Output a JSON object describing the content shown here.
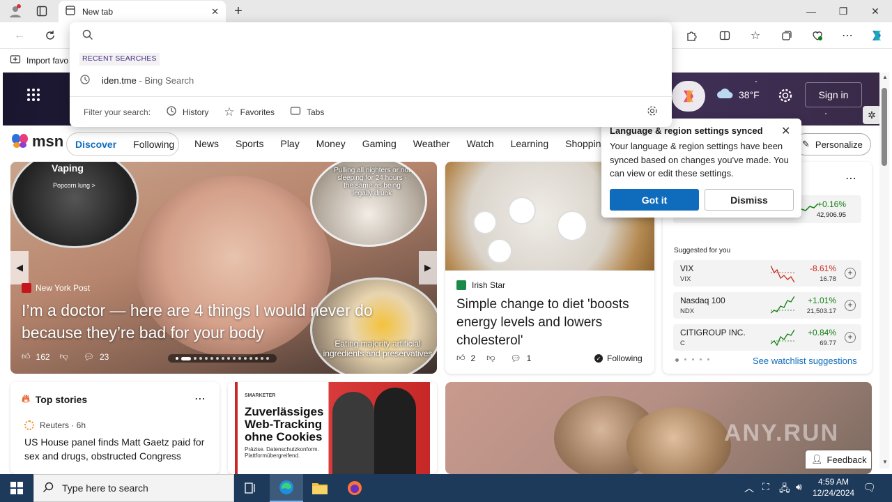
{
  "browser": {
    "tab_title": "New tab",
    "favorites_bar": {
      "import_label": "Import favo"
    },
    "window_controls": {
      "minimize": "—",
      "maximize": "❐",
      "close": "✕"
    }
  },
  "omnibox": {
    "recent_label": "RECENT SEARCHES",
    "recent_item": {
      "query": "iden.tme",
      "source": "- Bing Search"
    },
    "filter_label": "Filter your search:",
    "filters": [
      "History",
      "Favorites",
      "Tabs"
    ]
  },
  "msn": {
    "logo": "msn",
    "weather": {
      "temp": "38°F"
    },
    "sign_in": "Sign in",
    "nav": {
      "discover": "Discover",
      "following": "Following",
      "items": [
        "News",
        "Sports",
        "Play",
        "Money",
        "Gaming",
        "Weather",
        "Watch",
        "Learning",
        "Shopping"
      ],
      "personalize": "Personalize"
    },
    "hero_card": {
      "source": "New York Post",
      "headline": "I’m a doctor — here are 4 things I would never do because they’re bad for your body",
      "likes": "162",
      "comments": "23",
      "overlay_1": "Vaping",
      "overlay_2": "Popcorn lung >",
      "overlay_3": "Pulling all nighters or not sleeping for 24 hours - the same as being legally drunk",
      "overlay_4": "Eating majority artificial ingredients and preservatives"
    },
    "irish_card": {
      "source": "Irish Star",
      "headline": "Simple change to diet 'boosts energy levels and lowers cholesterol'",
      "likes": "2",
      "comments": "1",
      "following": "Following"
    },
    "popup": {
      "title": "Language & region settings synced",
      "body": "Your language & region settings have been synced based on changes you've made. You can view or edit these settings.",
      "got_it": "Got it",
      "dismiss": "Dismiss"
    },
    "watchlist": {
      "top_change": "+0.16%",
      "top_value": "42,906.95",
      "suggested_label": "Suggested for you",
      "stocks": [
        {
          "name": "VIX",
          "symbol": "VIX",
          "change": "-8.61%",
          "value": "16.78",
          "color": "#c42b1c"
        },
        {
          "name": "Nasdaq 100",
          "symbol": "NDX",
          "change": "+1.01%",
          "value": "21,503.17",
          "color": "#107c10"
        },
        {
          "name": "CITIGROUP INC.",
          "symbol": "C",
          "change": "+0.84%",
          "value": "69.77",
          "color": "#107c10"
        }
      ],
      "see_more": "See watchlist suggestions"
    },
    "top_stories": {
      "title": "Top stories",
      "source": "Reuters · 6h",
      "headline": "US House panel finds Matt Gaetz paid for sex and drugs, obstructed Congress"
    },
    "ad": {
      "brand": "SMARKETER",
      "headline": "Zuverlässiges Web-Tracking ohne Cookies",
      "sub": "Präzise. Datenschutzkonform. Plattformübergreifend."
    },
    "feedback": "Feedback",
    "watermark": "ANY.RUN"
  },
  "taskbar": {
    "search_placeholder": "Type here to search",
    "time": "4:59 AM",
    "date": "12/24/2024"
  },
  "colors": {
    "accent": "#0f6cbd",
    "taskbar": "#1e3a5a"
  }
}
